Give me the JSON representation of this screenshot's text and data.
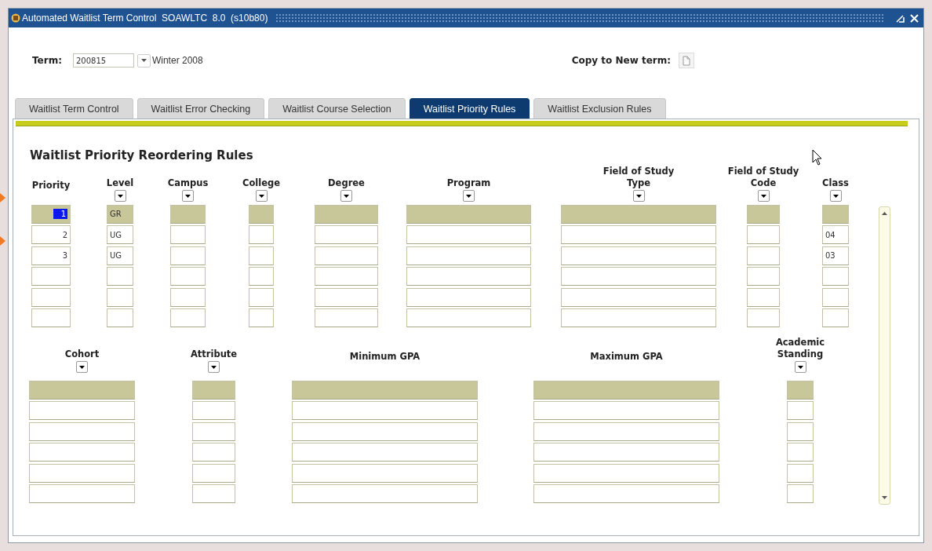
{
  "window": {
    "title": "Automated Waitlist Term Control  SOAWLTC  8.0  (s10b80)"
  },
  "term": {
    "label": "Term:",
    "value": "200815",
    "description": "Winter 2008"
  },
  "copy": {
    "label": "Copy to New term:"
  },
  "tabs": [
    {
      "label": "Waitlist Term Control",
      "selected": false
    },
    {
      "label": "Waitlist Error Checking",
      "selected": false
    },
    {
      "label": "Waitlist Course Selection",
      "selected": false
    },
    {
      "label": "Waitlist Priority Rules",
      "selected": true
    },
    {
      "label": "Waitlist Exclusion Rules",
      "selected": false
    }
  ],
  "section": {
    "title": "Waitlist Priority Reordering Rules"
  },
  "rules": {
    "columns": [
      {
        "label": "Priority",
        "lov": false
      },
      {
        "label": "Level",
        "lov": true
      },
      {
        "label": "Campus",
        "lov": true
      },
      {
        "label": "College",
        "lov": true
      },
      {
        "label": "Degree",
        "lov": true
      },
      {
        "label": "Program",
        "lov": true
      },
      {
        "label": "Field of Study\nType",
        "lov": true
      },
      {
        "label": "Field of Study\nCode",
        "lov": true
      },
      {
        "label": "Class",
        "lov": true
      }
    ],
    "rows": [
      {
        "selected": true,
        "cells": [
          "1",
          "GR",
          null,
          null,
          null,
          null,
          null,
          null,
          null
        ]
      },
      {
        "selected": false,
        "cells": [
          "2",
          "UG",
          null,
          null,
          null,
          null,
          null,
          null,
          "04"
        ]
      },
      {
        "selected": false,
        "cells": [
          "3",
          "UG",
          null,
          null,
          null,
          null,
          null,
          null,
          "03"
        ]
      },
      {
        "selected": false
      },
      {
        "selected": false
      },
      {
        "selected": false
      }
    ]
  },
  "qualifications": {
    "columns": [
      {
        "label": "Cohort",
        "lov": true
      },
      {
        "label": "Attribute",
        "lov": true
      },
      {
        "label": "Minimum GPA",
        "lov": false
      },
      {
        "label": "Maximum GPA",
        "lov": false
      },
      {
        "label": "Academic\nStanding",
        "lov": true
      }
    ],
    "rows": [
      {
        "selected": true
      },
      {
        "selected": false
      },
      {
        "selected": false
      },
      {
        "selected": false
      },
      {
        "selected": false
      },
      {
        "selected": false
      }
    ]
  }
}
